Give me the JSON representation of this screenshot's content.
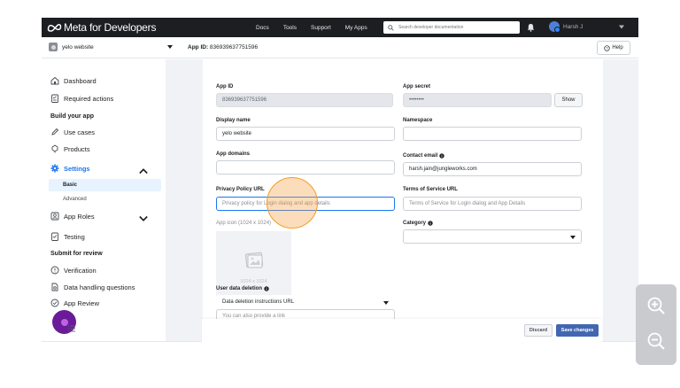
{
  "topnav": {
    "brand": "Meta for Developers",
    "links": [
      "Docs",
      "Tools",
      "Support",
      "My Apps"
    ],
    "search_placeholder": "Search developer documentation",
    "user_name": "Harsh J"
  },
  "subheader": {
    "app_name": "yelo website",
    "app_id_label": "App ID:",
    "app_id_value": "836939637751596",
    "help_label": "Help"
  },
  "sidebar": {
    "dashboard": "Dashboard",
    "required_actions": "Required actions",
    "build_heading": "Build your app",
    "use_cases": "Use cases",
    "products": "Products",
    "settings": "Settings",
    "basic": "Basic",
    "advanced": "Advanced",
    "app_roles": "App Roles",
    "testing": "Testing",
    "review_heading": "Submit for review",
    "verification": "Verification",
    "data_handling": "Data handling questions",
    "app_review": "App Review"
  },
  "form": {
    "app_id_label": "App ID",
    "app_id_value": "836939637751596",
    "app_secret_label": "App secret",
    "app_secret_value": "••••••••",
    "show_label": "Show",
    "display_name_label": "Display name",
    "display_name_value": "yelo website",
    "namespace_label": "Namespace",
    "app_domains_label": "App domains",
    "contact_email_label": "Contact email",
    "contact_email_value": "harsh.jain@jungleworks.com",
    "privacy_label": "Privacy Policy URL",
    "privacy_placeholder": "Privacy policy for Login dialog and app details",
    "terms_label": "Terms of Service URL",
    "terms_placeholder": "Terms of Service for Login dialog and App Details",
    "app_icon_label": "App icon (1024 x 1024)",
    "app_icon_size": "1024 x 1024",
    "category_label": "Category",
    "deletion_label": "User data deletion",
    "deletion_select": "Data deletion instructions URL",
    "deletion_hint": "You can also provide a link"
  },
  "footer": {
    "discard": "Discard",
    "save": "Save changes"
  },
  "colors": {
    "nav_bg": "#1c1e21",
    "accent": "#1877f2",
    "save_button": "#4267b2",
    "click_highlight": "#f59a23",
    "recorder_dot": "#6a1b9a"
  },
  "icons": [
    "meta-logo-icon",
    "search-icon",
    "bell-icon",
    "help-circle-icon",
    "dashboard-icon",
    "checklist-icon",
    "pencil-icon",
    "products-icon",
    "gear-icon",
    "roles-icon",
    "testing-icon",
    "shield-icon",
    "document-icon",
    "review-icon",
    "info-icon",
    "image-placeholder-icon",
    "zoom-in-icon",
    "zoom-out-icon"
  ]
}
